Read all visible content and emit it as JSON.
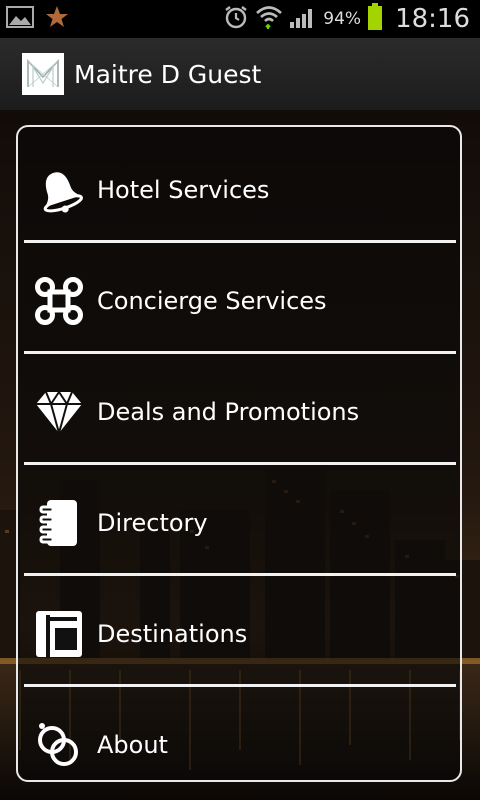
{
  "status_bar": {
    "battery": "94%",
    "time": "18:16"
  },
  "app": {
    "title": "Maitre D Guest"
  },
  "menu": [
    {
      "label": "Hotel Services",
      "icon": "bell-icon"
    },
    {
      "label": "Concierge Services",
      "icon": "command-icon"
    },
    {
      "label": "Deals and Promotions",
      "icon": "diamond-icon"
    },
    {
      "label": "Directory",
      "icon": "notebook-icon"
    },
    {
      "label": "Destinations",
      "icon": "layout-icon"
    },
    {
      "label": "About",
      "icon": "rings-icon"
    }
  ],
  "colors": {
    "panel_border": "#e9e9e9",
    "battery": "#a4d400"
  }
}
